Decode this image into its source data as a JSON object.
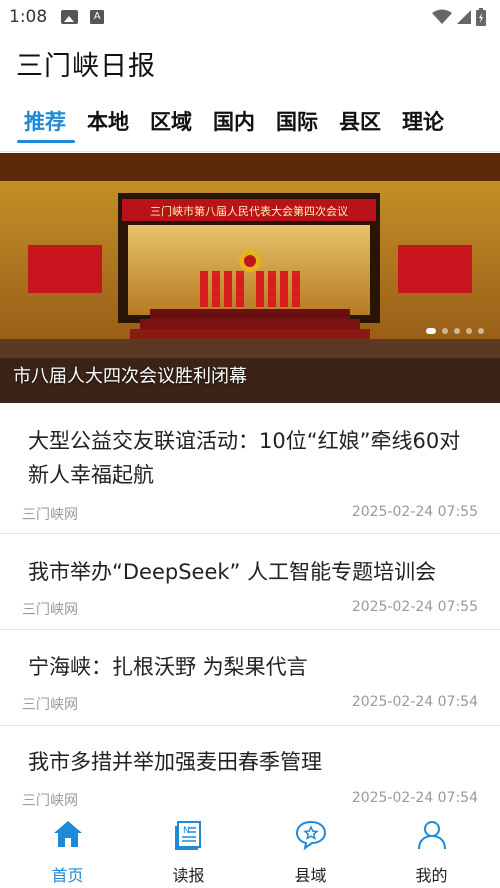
{
  "status_bar": {
    "time": "1:08",
    "icons": [
      "image-icon",
      "a-icon",
      "wifi-icon",
      "signal-icon",
      "battery-icon"
    ]
  },
  "app": {
    "title": "三门峡日报"
  },
  "tabs": [
    {
      "label": "推荐",
      "active": true
    },
    {
      "label": "本地",
      "active": false
    },
    {
      "label": "区域",
      "active": false
    },
    {
      "label": "国内",
      "active": false
    },
    {
      "label": "国际",
      "active": false
    },
    {
      "label": "县区",
      "active": false
    },
    {
      "label": "理论",
      "active": false
    }
  ],
  "banner": {
    "caption": "市八届人大四次会议胜利闭幕",
    "stage_banner_text": "三门峡市第八届人民代表大会第四次会议",
    "slide_count": 5,
    "active_slide": 1
  },
  "news": [
    {
      "title": "大型公益交友联谊活动：10位“红娘”牵线60对新人幸福起航",
      "source": "三门峡网",
      "time": "2025-02-24 07:55"
    },
    {
      "title": "我市举办“DeepSeek” 人工智能专题培训会",
      "source": "三门峡网",
      "time": "2025-02-24 07:55"
    },
    {
      "title": "宁海峡：扎根沃野 为梨果代言",
      "source": "三门峡网",
      "time": "2025-02-24 07:54"
    },
    {
      "title": "我市多措并举加强麦田春季管理",
      "source": "三门峡网",
      "time": "2025-02-24 07:54"
    }
  ],
  "bottom_nav": [
    {
      "label": "首页",
      "icon": "home-icon",
      "active": true
    },
    {
      "label": "读报",
      "icon": "newspaper-icon",
      "active": false
    },
    {
      "label": "县域",
      "icon": "star-chat-icon",
      "active": false
    },
    {
      "label": "我的",
      "icon": "user-icon",
      "active": false
    }
  ],
  "colors": {
    "accent": "#1f8ad6",
    "text": "#222222",
    "meta": "#9a9a9a"
  }
}
